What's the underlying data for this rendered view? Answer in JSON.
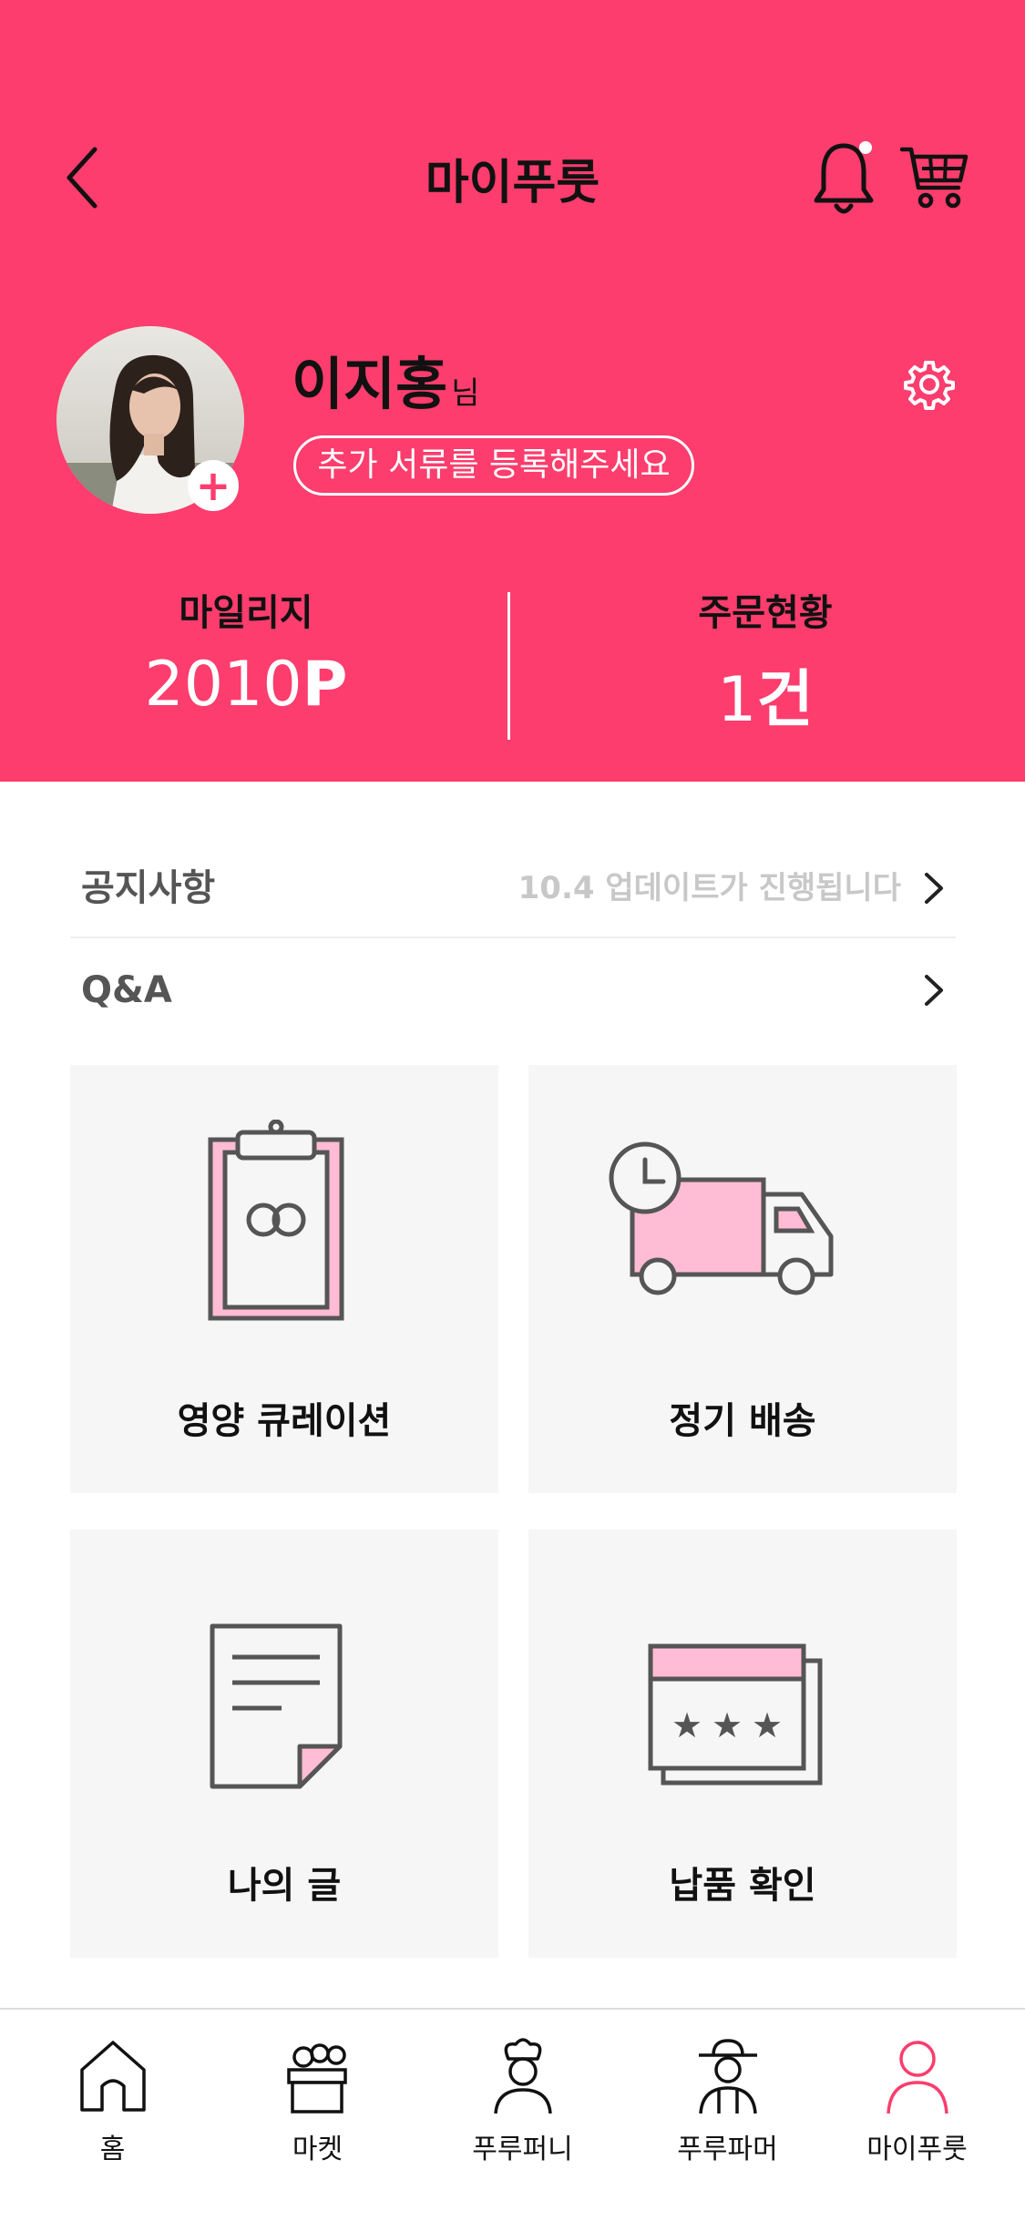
{
  "header": {
    "title": "마이푸룻",
    "accent_color": "#fc3d6d"
  },
  "profile": {
    "name": "이지홍",
    "name_suffix": "님",
    "document_prompt": "추가 서류를 등록해주세요"
  },
  "stats": {
    "mileage_label": "마일리지",
    "mileage_value": "2010",
    "mileage_unit": "P",
    "orders_label": "주문현황",
    "orders_value": "1",
    "orders_unit": "건"
  },
  "rows": {
    "notice_label": "공지사항",
    "notice_text": "10.4 업데이트가 진행됩니다",
    "qa_label": "Q&A"
  },
  "cards": [
    {
      "label": "영양 큐레이션"
    },
    {
      "label": "정기 배송"
    },
    {
      "label": "나의 글"
    },
    {
      "label": "납품 확인"
    }
  ],
  "nav": [
    {
      "label": "홈",
      "icon": "home-icon"
    },
    {
      "label": "마켓",
      "icon": "market-basket-icon"
    },
    {
      "label": "푸루퍼니",
      "icon": "chef-icon"
    },
    {
      "label": "푸루파머",
      "icon": "farmer-icon"
    },
    {
      "label": "마이푸룻",
      "icon": "user-icon",
      "active": true
    }
  ]
}
